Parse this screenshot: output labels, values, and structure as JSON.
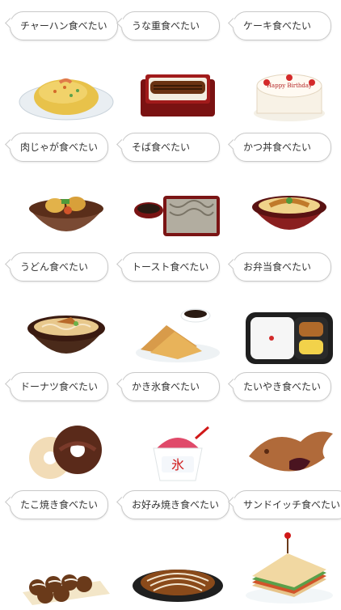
{
  "stickers": [
    {
      "label": "チャーハン食べたい",
      "icon": "fried-rice-icon"
    },
    {
      "label": "うな重食べたい",
      "icon": "unaju-icon"
    },
    {
      "label": "ケーキ食べたい",
      "icon": "cake-icon",
      "cake_text": "Happy Birthday"
    },
    {
      "label": "肉じゃが食べたい",
      "icon": "nikujaga-icon"
    },
    {
      "label": "そば食べたい",
      "icon": "soba-icon"
    },
    {
      "label": "かつ丼食べたい",
      "icon": "katsudon-icon"
    },
    {
      "label": "うどん食べたい",
      "icon": "udon-icon"
    },
    {
      "label": "トースト食べたい",
      "icon": "toast-icon"
    },
    {
      "label": "お弁当食べたい",
      "icon": "bento-icon"
    },
    {
      "label": "ドーナツ食べたい",
      "icon": "donut-icon"
    },
    {
      "label": "かき氷食べたい",
      "icon": "shaved-ice-icon",
      "cup_text": "氷"
    },
    {
      "label": "たいやき食べたい",
      "icon": "taiyaki-icon"
    },
    {
      "label": "たこ焼き食べたい",
      "icon": "takoyaki-icon"
    },
    {
      "label": "お好み焼き食べたい",
      "icon": "okonomiyaki-icon"
    },
    {
      "label": "サンドイッチ食べたい",
      "icon": "sandwich-icon"
    }
  ]
}
